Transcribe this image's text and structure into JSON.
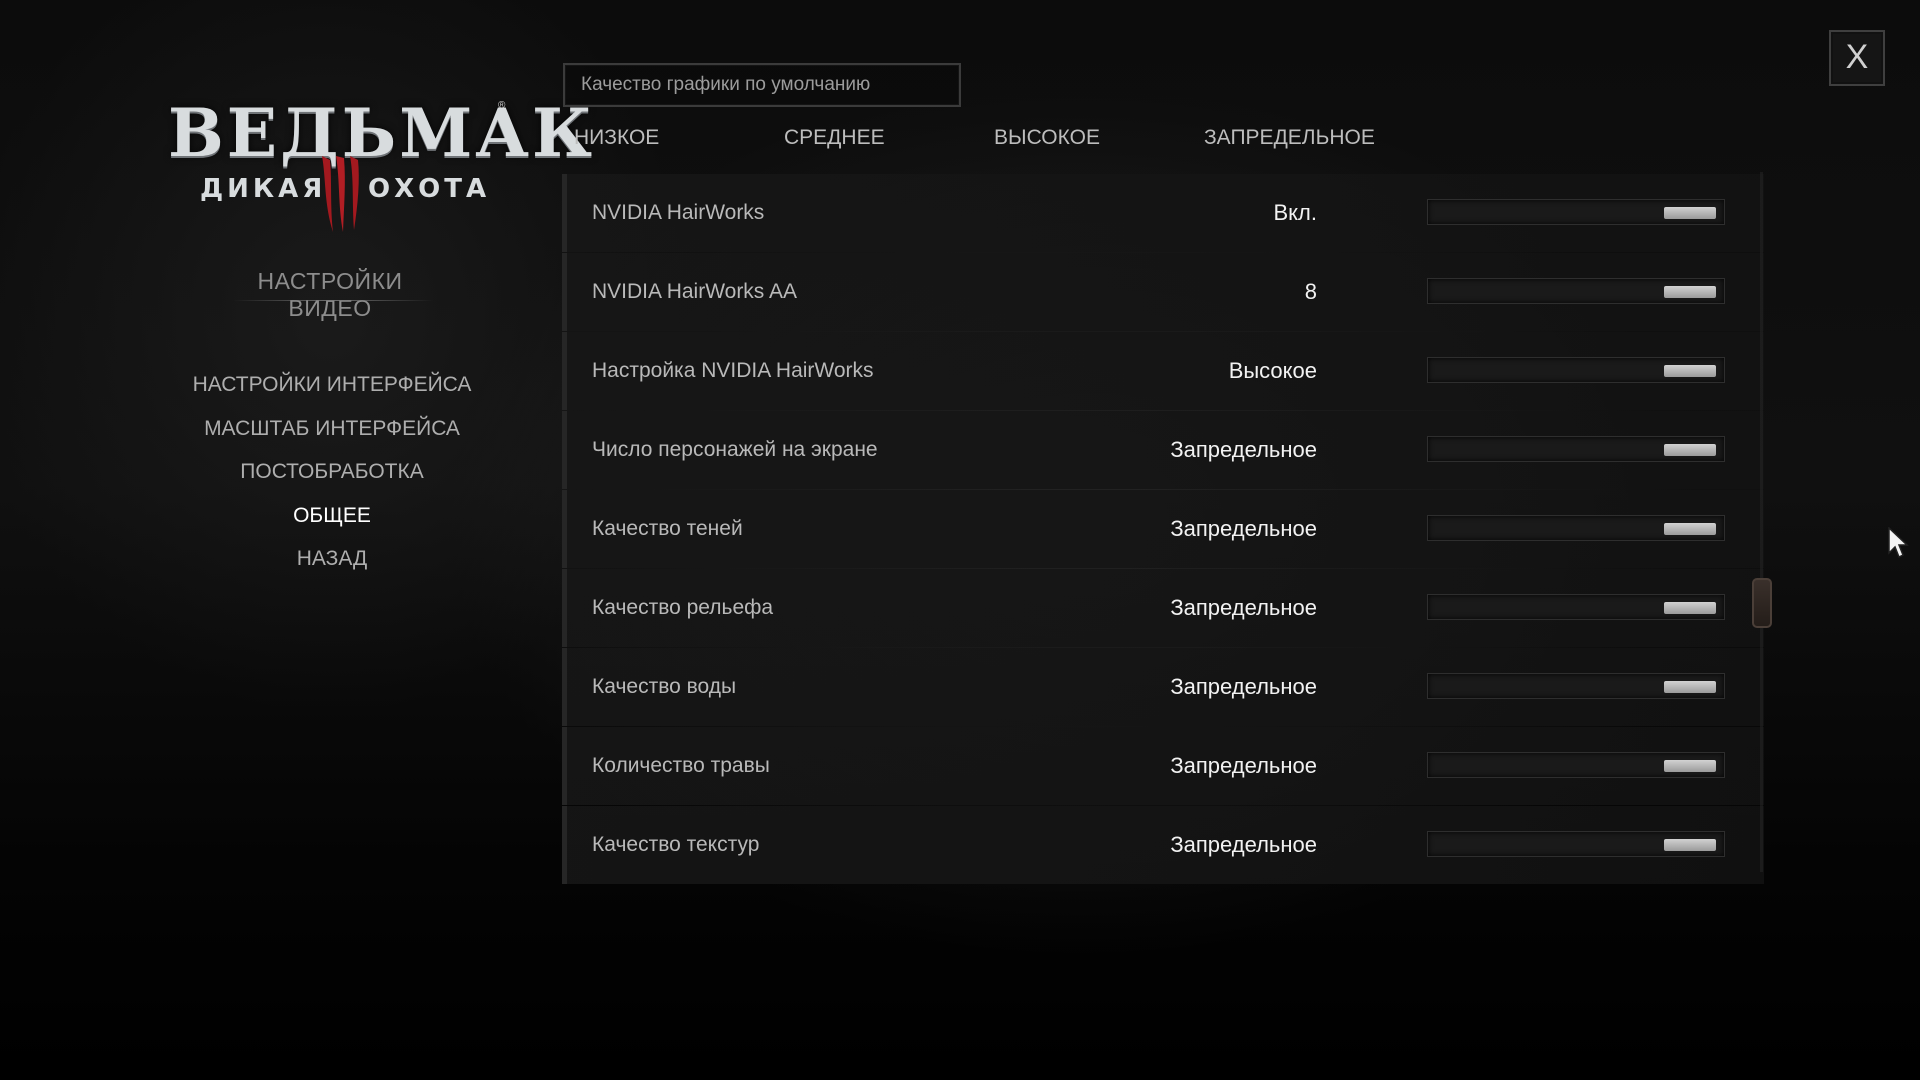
{
  "logo": {
    "title": "ВЕДЬМАК",
    "subtitle_left": "ДИКАЯ",
    "subtitle_right": "ОХОТА",
    "registered_mark": "®"
  },
  "sidebar": {
    "heading": "НАСТРОЙКИ ВИДЕО",
    "items": [
      {
        "label": "НАСТРОЙКИ ИНТЕРФЕЙСА",
        "active": false
      },
      {
        "label": "МАСШТАБ ИНТЕРФЕЙСА",
        "active": false
      },
      {
        "label": "ПОСТОБРАБОТКА",
        "active": false
      },
      {
        "label": "ОБЩЕЕ",
        "active": true
      },
      {
        "label": "НАЗАД",
        "active": false
      }
    ]
  },
  "preset": {
    "label": "Качество графики по умолчанию",
    "tabs": [
      "НИЗКОЕ",
      "СРЕДНЕЕ",
      "ВЫСОКОЕ",
      "ЗАПРЕДЕЛЬНОЕ"
    ]
  },
  "settings": [
    {
      "label": "NVIDIA HairWorks",
      "value": "Вкл.",
      "level": 1.0
    },
    {
      "label": "NVIDIA HairWorks AA",
      "value": "8",
      "level": 1.0
    },
    {
      "label": "Настройка NVIDIA HairWorks",
      "value": "Высокое",
      "level": 1.0
    },
    {
      "label": "Число персонажей на экране",
      "value": "Запредельное",
      "level": 1.0
    },
    {
      "label": "Качество теней",
      "value": "Запредельное",
      "level": 1.0
    },
    {
      "label": "Качество рельефа",
      "value": "Запредельное",
      "level": 1.0
    },
    {
      "label": "Качество воды",
      "value": "Запредельное",
      "level": 1.0
    },
    {
      "label": "Количество травы",
      "value": "Запредельное",
      "level": 1.0
    },
    {
      "label": "Качество текстур",
      "value": "Запредельное",
      "level": 1.0
    }
  ],
  "close_button": {
    "label": "X"
  },
  "colors": {
    "accent_claws": "#a3191f",
    "active_text": "#ffffff",
    "inactive_text": "#aeaeae",
    "scroll_thumb_border": "#4b3f38"
  },
  "icons": {
    "close": "close-icon",
    "cursor": "mouse-pointer-icon",
    "logo_emblem": "claw-marks-icon"
  }
}
